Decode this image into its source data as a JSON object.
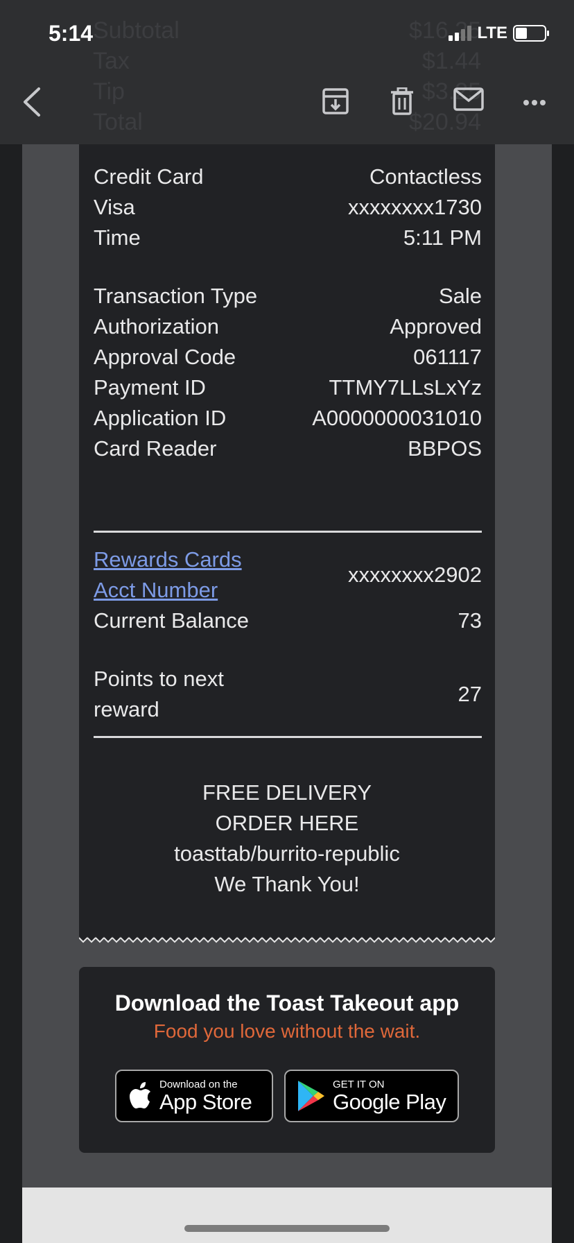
{
  "status_bar": {
    "time": "5:14",
    "network": "LTE"
  },
  "background_ghost": [
    {
      "label": "Subtotal",
      "value": "$16.25"
    },
    {
      "label": "Tax",
      "value": "$1.44"
    },
    {
      "label": "Tip",
      "value": "$3.25"
    },
    {
      "label": "Total",
      "value": "$20.94"
    }
  ],
  "toolbar": {
    "icons": [
      "chevron-left-icon",
      "archive-icon",
      "trash-icon",
      "mail-icon",
      "more-horizontal-icon"
    ]
  },
  "payment": {
    "credit_card": {
      "label": "Credit Card",
      "value": "Contactless"
    },
    "card_brand": {
      "label": "Visa",
      "value": "xxxxxxxx1730"
    },
    "time": {
      "label": "Time",
      "value": "5:11 PM"
    },
    "transaction_type": {
      "label": "Transaction Type",
      "value": "Sale"
    },
    "authorization": {
      "label": "Authorization",
      "value": "Approved"
    },
    "approval_code": {
      "label": "Approval Code",
      "value": "061117"
    },
    "payment_id": {
      "label": "Payment ID",
      "value": "TTMY7LLsLxYz"
    },
    "application_id": {
      "label": "Application ID",
      "value": "A0000000031010"
    },
    "card_reader": {
      "label": "Card Reader",
      "value": "BBPOS"
    }
  },
  "rewards": {
    "link_line1": "Rewards Cards",
    "link_line2": "Acct Number",
    "acct_number": "xxxxxxxx2902",
    "balance_label": "Current Balance",
    "balance_value": "73",
    "points_label_line1": "Points to next",
    "points_label_line2": "reward",
    "points_value": "27"
  },
  "footer_lines": [
    "FREE DELIVERY",
    "ORDER HERE",
    "toasttab/burrito-republic",
    "We Thank You!"
  ],
  "promo": {
    "title": "Download the Toast Takeout app",
    "subtitle": "Food you love without the wait.",
    "app_store": {
      "small": "Download on the",
      "big": "App Store"
    },
    "google_play": {
      "small": "GET IT ON",
      "big": "Google Play"
    }
  },
  "colors": {
    "link": "#7d9be6",
    "promo_subtitle": "#e0683a",
    "receipt_bg": "#212225"
  }
}
